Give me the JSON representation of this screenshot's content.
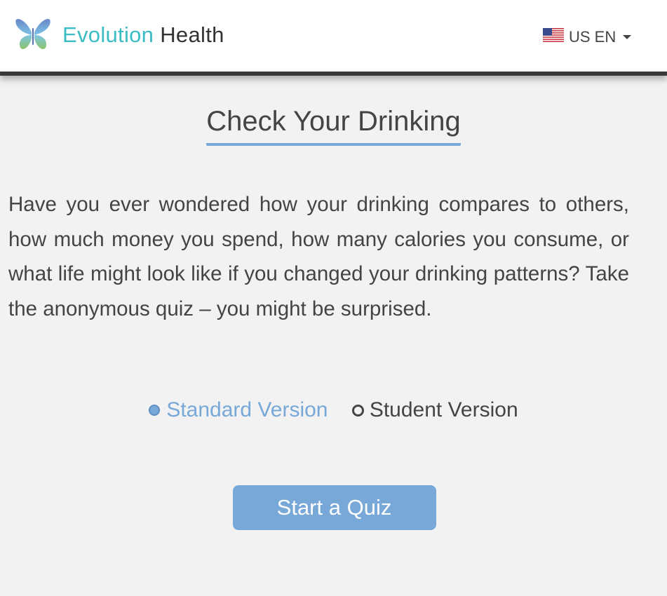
{
  "header": {
    "brand_part1": "Evolution",
    "brand_part2": "Health",
    "logo_icon": "butterfly-icon",
    "language": {
      "label": "US EN",
      "flag_icon": "us-flag-icon"
    }
  },
  "main": {
    "title": "Check Your Drinking",
    "intro": "Have you ever wondered how your drinking compares to others, how much money you spend, how many calories you consume, or what life might look like if you changed your drinking patterns? Take the anonymous quiz – you might be surprised.",
    "versions": [
      {
        "label": "Standard Version",
        "selected": true
      },
      {
        "label": "Student Version",
        "selected": false
      }
    ],
    "start_button": "Start a Quiz"
  },
  "colors": {
    "accent": "#78a8d7",
    "brand_teal": "#3bbcc4",
    "text": "#444444",
    "background": "#f2f2f2"
  }
}
